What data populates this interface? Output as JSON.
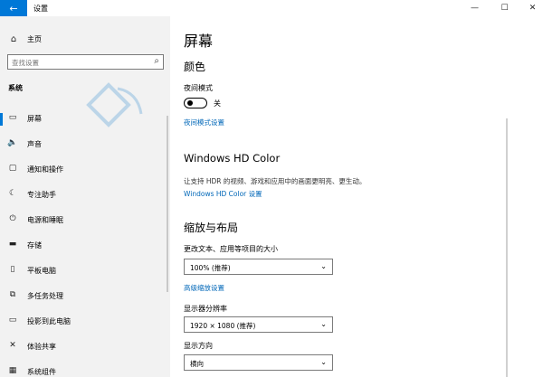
{
  "window": {
    "title": "设置",
    "min_glyph": "—",
    "max_glyph": "☐",
    "close_glyph": "✕",
    "back_glyph": "←"
  },
  "sidebar": {
    "home_label": "主页",
    "search_placeholder": "查找设置",
    "section": "系统",
    "items": [
      {
        "label": "屏幕",
        "icon": "monitor-icon",
        "glyph": "▭"
      },
      {
        "label": "声音",
        "icon": "speaker-icon",
        "glyph": "🔈"
      },
      {
        "label": "通知和操作",
        "icon": "notification-icon",
        "glyph": "▢"
      },
      {
        "label": "专注助手",
        "icon": "moon-icon",
        "glyph": "☾"
      },
      {
        "label": "电源和睡眠",
        "icon": "power-icon",
        "glyph": "⏻"
      },
      {
        "label": "存储",
        "icon": "storage-icon",
        "glyph": "▬"
      },
      {
        "label": "平板电脑",
        "icon": "tablet-icon",
        "glyph": "▯"
      },
      {
        "label": "多任务处理",
        "icon": "multitask-icon",
        "glyph": "⧉"
      },
      {
        "label": "投影到此电脑",
        "icon": "project-icon",
        "glyph": "▭"
      },
      {
        "label": "体验共享",
        "icon": "share-icon",
        "glyph": "✕"
      },
      {
        "label": "系统组件",
        "icon": "components-icon",
        "glyph": "▦"
      }
    ]
  },
  "main": {
    "title": "屏幕",
    "color_heading": "颜色",
    "night_mode_label": "夜间模式",
    "night_mode_state": "关",
    "night_mode_link": "夜间模式设置",
    "hd_heading": "Windows HD Color",
    "hd_desc": "让支持 HDR 的视频、游戏和应用中的画面更明亮、更生动。",
    "hd_link": "Windows HD Color 设置",
    "scale_heading": "缩放与布局",
    "scale_label": "更改文本、应用等项目的大小",
    "scale_value": "100% (推荐)",
    "advanced_link": "高级缩放设置",
    "resolution_label": "显示器分辨率",
    "resolution_value": "1920 × 1080 (推荐)",
    "orientation_label": "显示方向",
    "orientation_value": "横向"
  },
  "colors": {
    "accent": "#0078d7",
    "link": "#0067b8",
    "sidebar_bg": "#f2f2f2"
  }
}
